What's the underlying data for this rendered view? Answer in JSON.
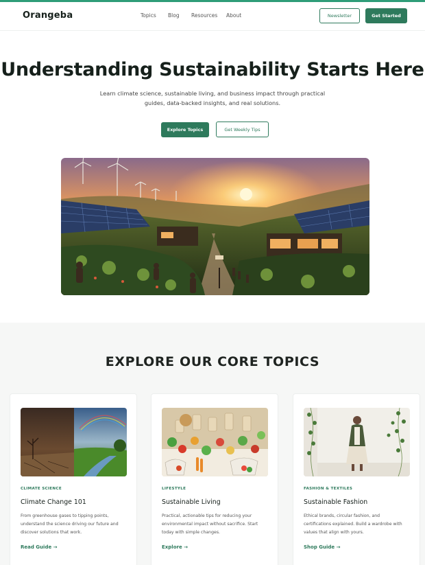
{
  "brand": {
    "name": "Orangeba"
  },
  "nav": {
    "items": [
      "Topics",
      "Blog",
      "Resources",
      "About"
    ]
  },
  "header_buttons": {
    "newsletter": "Newsletter",
    "get_started": "Get Started"
  },
  "hero": {
    "title": "Understanding Sustainability Starts Here",
    "subtitle": "Learn climate science, sustainable living, and business impact through practical guides, data-backed insights, and real solutions.",
    "primary_cta": "Explore Topics",
    "secondary_cta": "Get Weekly Tips"
  },
  "topics": {
    "heading": "EXPLORE OUR CORE TOPICS",
    "cards": [
      {
        "category": "CLIMATE SCIENCE",
        "title": "Climate Change 101",
        "description": "From greenhouse gases to tipping points, understand the science driving our future and discover solutions that work.",
        "link": "Read Guide →"
      },
      {
        "category": "LIFESTYLE",
        "title": "Sustainable Living",
        "description": "Practical, actionable tips for reducing your environmental impact without sacrifice. Start today with simple changes.",
        "link": "Explore →"
      },
      {
        "category": "FASHION & TEXTILES",
        "title": "Sustainable Fashion",
        "description": "Ethical brands, circular fashion, and certifications explained. Build a wardrobe with values that align with yours.",
        "link": "Shop Guide →"
      }
    ]
  },
  "colors": {
    "accent": "#2e7a5c",
    "topbar": "#2f9d78",
    "section_bg": "#f6f7f6"
  }
}
